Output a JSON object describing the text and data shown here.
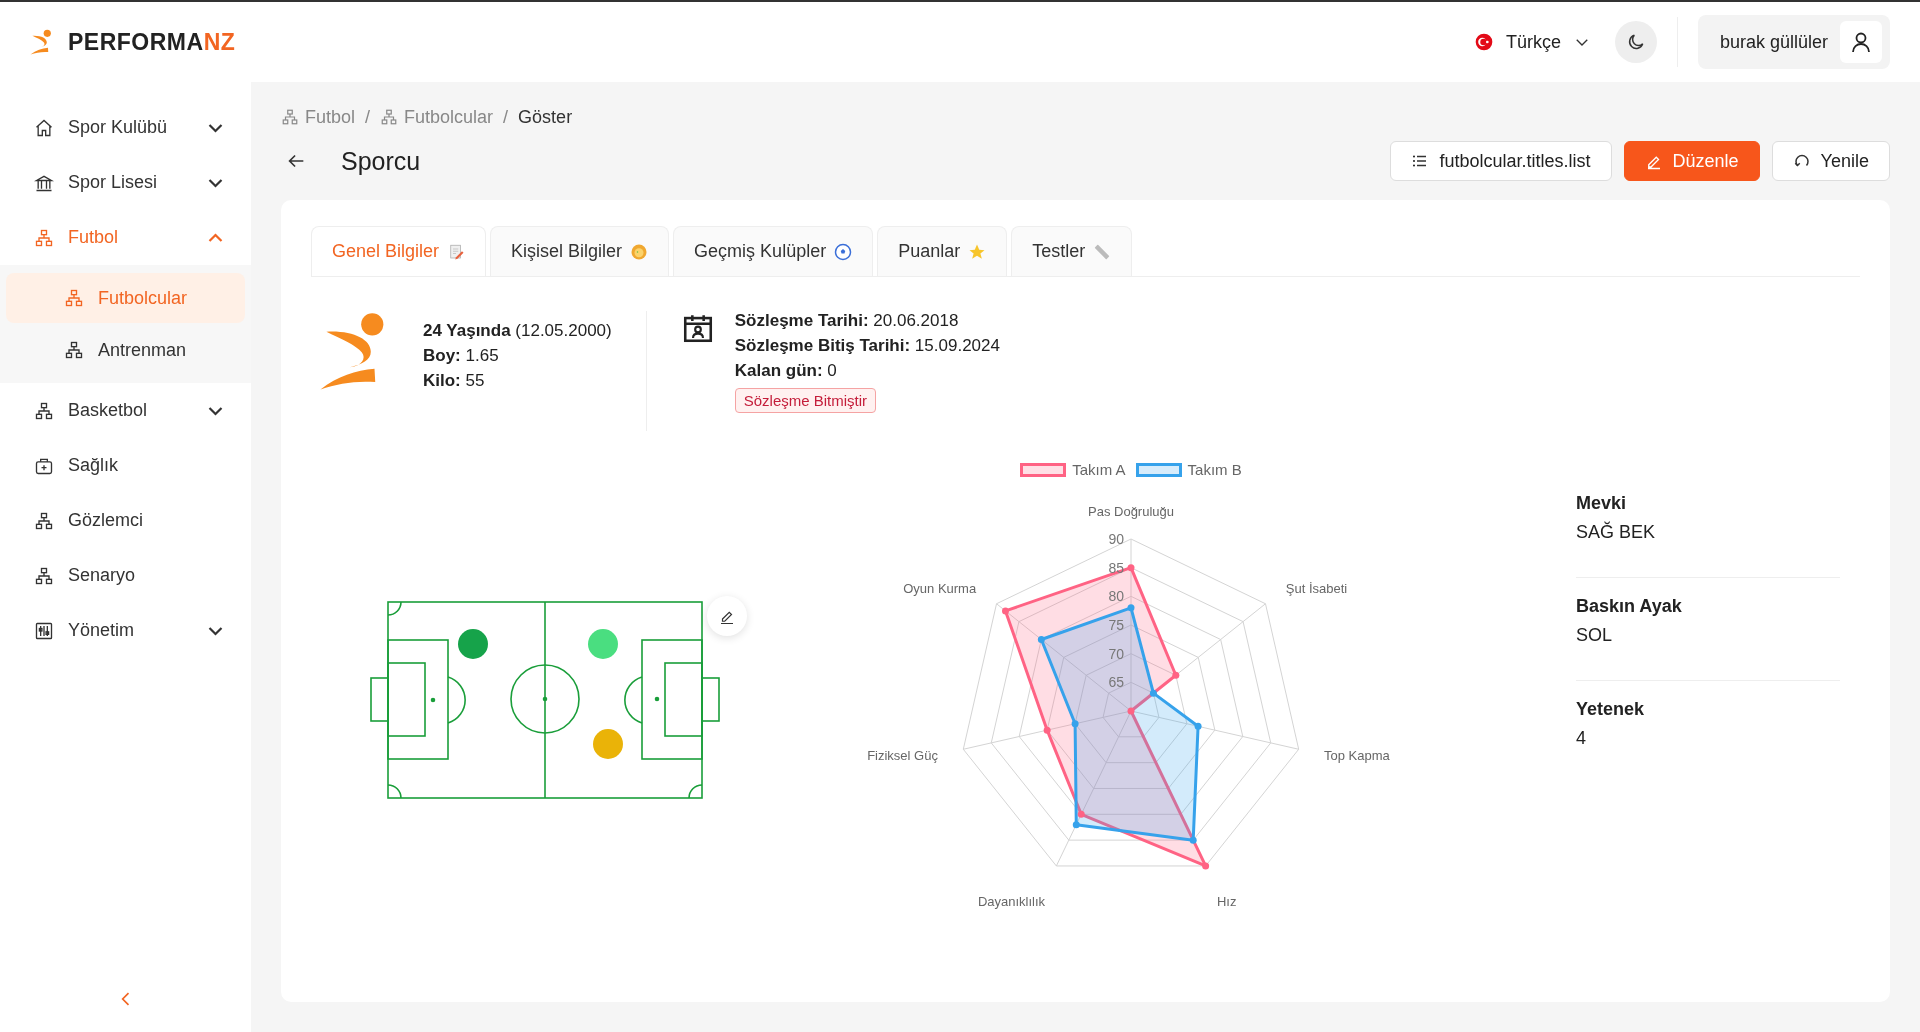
{
  "brand": {
    "name": "PERFORMA",
    "accent": "NZ"
  },
  "header": {
    "language": "Türkçe",
    "user": "burak güllüler"
  },
  "sidebar": {
    "items": [
      {
        "label": "Spor Kulübü",
        "expanded": false,
        "selected": false
      },
      {
        "label": "Spor Lisesi",
        "expanded": false,
        "selected": false
      },
      {
        "label": "Futbol",
        "expanded": true,
        "selected": true,
        "children": [
          {
            "label": "Futbolcular",
            "selected": true
          },
          {
            "label": "Antrenman",
            "selected": false
          }
        ]
      },
      {
        "label": "Basketbol",
        "expanded": false,
        "selected": false
      },
      {
        "label": "Sağlık",
        "selected": false
      },
      {
        "label": "Gözlemci",
        "selected": false
      },
      {
        "label": "Senaryo",
        "selected": false
      },
      {
        "label": "Yönetim",
        "expanded": false,
        "selected": false
      }
    ]
  },
  "breadcrumb": [
    {
      "label": "Futbol",
      "kind": "link"
    },
    {
      "label": "/",
      "kind": "separator"
    },
    {
      "label": "Futbolcular",
      "kind": "link"
    },
    {
      "label": "/",
      "kind": "separator"
    },
    {
      "label": "Göster",
      "kind": "current"
    }
  ],
  "page": {
    "title": "Sporcu",
    "actions": [
      {
        "label": "futbolcular.titles.list",
        "kind": "list"
      },
      {
        "label": "Düzenle",
        "kind": "primary"
      },
      {
        "label": "Yenile",
        "kind": "refresh"
      }
    ]
  },
  "tabs": [
    {
      "label": "Genel Bilgiler",
      "selected": true
    },
    {
      "label": "Kişisel Bilgiler",
      "selected": false
    },
    {
      "label": "Geçmiş Kulüpler",
      "selected": false
    },
    {
      "label": "Puanlar",
      "selected": false
    },
    {
      "label": "Testler",
      "selected": false
    }
  ],
  "profile": {
    "lines": [
      "**24 Yaşında** (12.05.2000)",
      "**Boy:** 1.65",
      "**Kilo:** 55"
    ]
  },
  "contract": {
    "lines": [
      "**Sözleşme Tarihi:** 20.06.2018",
      "**Sözleşme Bitiş Tarihi:** 15.09.2024",
      "**Kalan gün:** 0"
    ],
    "status": "Sözleşme Bitmiştir"
  },
  "pitch": {
    "players": [
      {
        "color": "#16a34a"
      },
      {
        "color": "#4ade80"
      },
      {
        "color": "#eab308"
      }
    ]
  },
  "chart": {
    "chart_data": {
      "type": "radar",
      "categories": [
        "Pas Doğruluğu",
        "Şut İsabeti",
        "Top Kapma",
        "Hız",
        "Dayanıklılık",
        "Fiziksel Güç",
        "Oyun Kurma"
      ],
      "series": [
        {
          "name": "Takım A",
          "color": "#ff6384",
          "values": [
            85,
            70,
            60,
            90,
            80,
            75,
            88
          ]
        },
        {
          "name": "Takım B",
          "color": "#36a2eb",
          "values": [
            78,
            65,
            72,
            85,
            82,
            70,
            80
          ]
        }
      ],
      "ylim": [
        60,
        90
      ],
      "yticks": [
        65,
        70,
        75,
        80,
        85,
        90
      ],
      "legend": "top"
    }
  },
  "attributes": [
    {
      "label": "Mevki",
      "value": "SAĞ BEK"
    },
    {
      "label": "Baskın Ayak",
      "value": "SOL"
    },
    {
      "label": "Yetenek",
      "value": "4"
    }
  ]
}
